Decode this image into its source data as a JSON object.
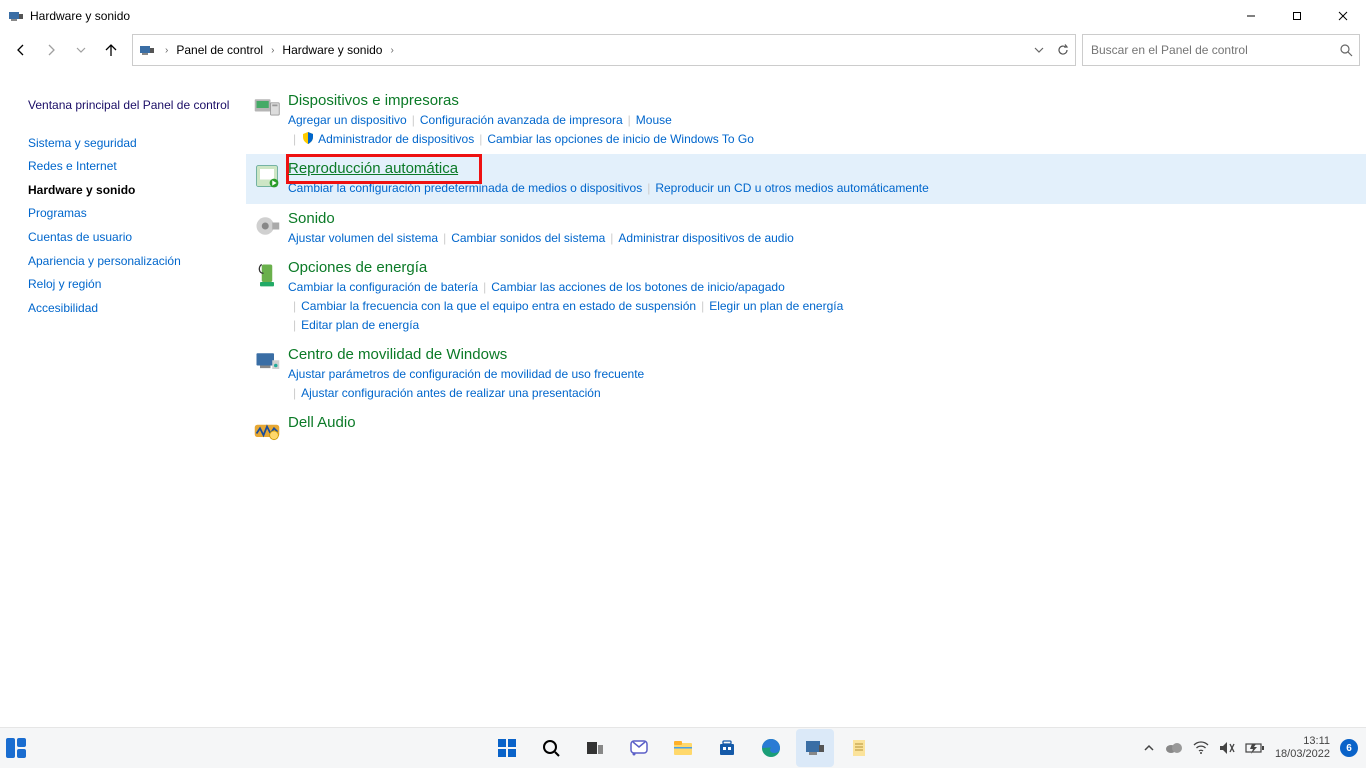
{
  "window": {
    "title": "Hardware y sonido",
    "min": "–",
    "max": "▢",
    "close": "✕"
  },
  "breadcrumb": {
    "root_icon": "pc-icon",
    "items": [
      "Panel de control",
      "Hardware y sonido"
    ]
  },
  "search": {
    "placeholder": "Buscar en el Panel de control"
  },
  "sidebar": {
    "home": "Ventana principal del Panel de control",
    "items": [
      "Sistema y seguridad",
      "Redes e Internet",
      "Hardware y sonido",
      "Programas",
      "Cuentas de usuario",
      "Apariencia y personalización",
      "Reloj y región",
      "Accesibilidad"
    ],
    "current_index": 2
  },
  "categories": [
    {
      "title": "Dispositivos e impresoras",
      "links": [
        {
          "label": "Agregar un dispositivo"
        },
        {
          "label": "Configuración avanzada de impresora"
        },
        {
          "label": "Mouse"
        },
        {
          "label": "Administrador de dispositivos",
          "shield": true
        },
        {
          "label": "Cambiar las opciones de inicio de Windows To Go"
        }
      ]
    },
    {
      "title": "Reproducción automática",
      "highlight": true,
      "redbox": true,
      "links": [
        {
          "label": "Cambiar la configuración predeterminada de medios o dispositivos"
        },
        {
          "label": "Reproducir un CD u otros medios automáticamente"
        }
      ]
    },
    {
      "title": "Sonido",
      "links": [
        {
          "label": "Ajustar volumen del sistema"
        },
        {
          "label": "Cambiar sonidos del sistema"
        },
        {
          "label": "Administrar dispositivos de audio"
        }
      ]
    },
    {
      "title": "Opciones de energía",
      "links": [
        {
          "label": "Cambiar la configuración de batería"
        },
        {
          "label": "Cambiar las acciones de los botones de inicio/apagado"
        },
        {
          "label": "Cambiar la frecuencia con la que el equipo entra en estado de suspensión"
        },
        {
          "label": "Elegir un plan de energía"
        },
        {
          "label": "Editar plan de energía"
        }
      ]
    },
    {
      "title": "Centro de movilidad de Windows",
      "links": [
        {
          "label": "Ajustar parámetros de configuración de movilidad de uso frecuente"
        },
        {
          "label": "Ajustar configuración antes de realizar una presentación"
        }
      ]
    },
    {
      "title": "Dell Audio",
      "links": []
    }
  ],
  "tray": {
    "time": "13:11",
    "date": "18/03/2022",
    "badge": "6"
  }
}
